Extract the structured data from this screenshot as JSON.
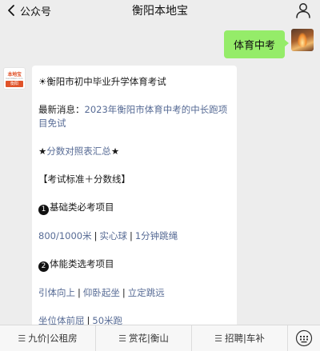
{
  "header": {
    "back_label": "公众号",
    "title": "衡阳本地宝"
  },
  "chat": {
    "my_message": "体育中考",
    "bot_avatar": {
      "logo_text": "本地宝",
      "logo_sub": "bendibao.com",
      "badge": "衡阳"
    },
    "bot_message": {
      "heading": "☀衡阳市初中毕业升学体育考试",
      "news_prefix": "最新消息：",
      "news_link": "2023年衡阳市体育中考的中长跑项目免试",
      "score_table_star_left": "★",
      "score_table_link": "分数对照表汇总",
      "score_table_star_right": "★",
      "section_title": "【考试标准＋分数线】",
      "section1_num": "1",
      "section1_title": "基础类必考项目",
      "section1_items": [
        "800/1000米",
        "实心球",
        "1分钟跳绳"
      ],
      "section2_num": "2",
      "section2_title": "体能类选考项目",
      "section2_row1": [
        "引体向上",
        "仰卧起坐",
        "立定跳远"
      ],
      "section2_row2": [
        "坐位体前屈",
        "50米跑"
      ],
      "separator": "|"
    }
  },
  "bottom_menu": {
    "items": [
      {
        "label": "九价|公租房"
      },
      {
        "label": "赏花|衡山"
      },
      {
        "label": "招聘|车补"
      }
    ]
  },
  "colors": {
    "link": "#576b95",
    "my_bubble": "#95ec69",
    "background": "#ededed"
  }
}
